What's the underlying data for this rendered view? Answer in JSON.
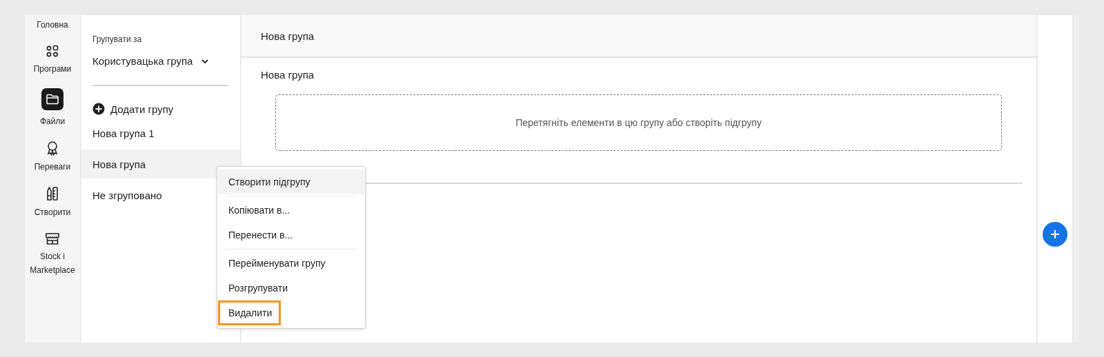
{
  "rail": [
    {
      "label": "Головна",
      "selected": false
    },
    {
      "label": "Програми",
      "selected": false
    },
    {
      "label": "Файли",
      "selected": true
    },
    {
      "label": "Переваги",
      "selected": false
    },
    {
      "label": "Створити",
      "selected": false
    },
    {
      "label": "Stock i Marketplace",
      "selected": false
    }
  ],
  "group_panel": {
    "group_by_label": "Групувати за",
    "group_by_value": "Користувацька група",
    "add_group": "Додати групу",
    "groups": [
      {
        "label": "Нова група 1",
        "selected": false
      },
      {
        "label": "Нова група",
        "selected": true
      },
      {
        "label": "Не згруповано",
        "selected": false
      }
    ]
  },
  "main": {
    "header": "Нова група",
    "section_title": "Нова група",
    "drop_hint": "Перетягніть елементи в цю групу або створіть підгрупу"
  },
  "context_menu": [
    {
      "label": "Створити підгрупу",
      "hovered": true,
      "callout": false,
      "divider_after": true
    },
    {
      "label": "Копіювати в...",
      "hovered": false,
      "callout": false,
      "divider_after": false
    },
    {
      "label": "Перенести в...",
      "hovered": false,
      "callout": false,
      "divider_after": true
    },
    {
      "label": "Перейменувати групу",
      "hovered": false,
      "callout": false,
      "divider_after": false
    },
    {
      "label": "Розгрупувати",
      "hovered": false,
      "callout": false,
      "divider_after": false
    },
    {
      "label": "Видалити",
      "hovered": false,
      "callout": true,
      "divider_after": false
    }
  ]
}
